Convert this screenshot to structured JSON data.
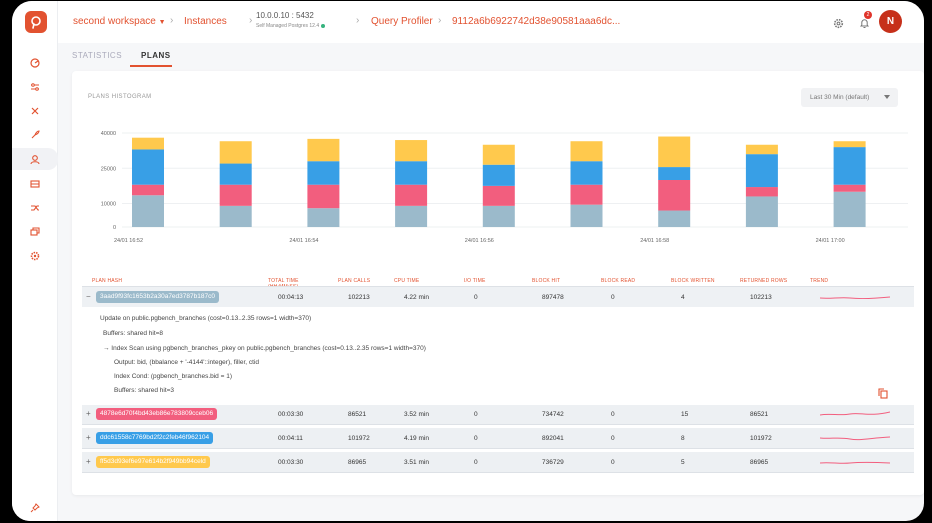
{
  "colors": {
    "accent": "#e25230",
    "series": [
      "#9bbacb",
      "#f25e7e",
      "#389fe6",
      "#ffc94d"
    ]
  },
  "sidebar": {
    "icons": [
      "dashboard-icon",
      "sliders-icon",
      "tools-icon",
      "rocket-icon",
      "user-search-icon",
      "server-icon",
      "shuffle-icon",
      "layers-icon",
      "gear-icon"
    ],
    "bottom_icon": "pin-icon"
  },
  "topbar": {
    "workspace": "second workspace",
    "instances": "Instances",
    "host": "10.0.0.10 : 5432",
    "host_sub": "Self Managed Postgres 12.4",
    "query_profiler": "Query Profiler",
    "query_id": "9112a6b6922742d38e90581aaa6dc...",
    "notif_count": "2",
    "avatar_initial": "N"
  },
  "tabs": [
    {
      "label": "STATISTICS",
      "active": false
    },
    {
      "label": "PLANS",
      "active": true
    }
  ],
  "card": {
    "title": "PLANS HISTOGRAM",
    "range_select": "Last 30 Min (default)"
  },
  "chart_data": {
    "type": "bar",
    "stacked": true,
    "title": "PLANS HISTOGRAM",
    "ylim": [
      0,
      40000
    ],
    "yticks": [
      "40000",
      "25000",
      "10000",
      "0"
    ],
    "ytick_values": [
      40000,
      25000,
      10000,
      0
    ],
    "xticks": [
      "24/01 16:52",
      "24/01 16:54",
      "24/01 16:56",
      "24/01 16:58",
      "24/01 17:00"
    ],
    "categories": [
      "1",
      "2",
      "3",
      "4",
      "5",
      "6",
      "7",
      "8",
      "9",
      "10",
      "11"
    ],
    "series": [
      {
        "values": [
          13500,
          9000,
          8000,
          9000,
          9000,
          9500,
          7000,
          13000,
          15000,
          15000,
          2500
        ]
      },
      {
        "values": [
          4500,
          9000,
          10000,
          9000,
          8500,
          8500,
          13000,
          4000,
          3000,
          2500,
          15000
        ]
      },
      {
        "values": [
          15000,
          9000,
          10000,
          10000,
          9000,
          10000,
          5500,
          14000,
          16000,
          16000,
          3000
        ]
      },
      {
        "values": [
          5000,
          9500,
          9500,
          9000,
          8500,
          8500,
          13000,
          4000,
          2500,
          2500,
          15000
        ]
      }
    ]
  },
  "table": {
    "headers": [
      "PLAN HASH",
      "TOTAL TIME\n(HH:MM:SS)",
      "PLAN CALLS",
      "CPU TIME",
      "I/O TIME",
      "BLOCK HIT",
      "BLOCK READ",
      "BLOCK WRITTEN",
      "RETURNED ROWS",
      "TREND"
    ],
    "rows": [
      {
        "expand": "−",
        "hash": "3aad9f93fc1653b2a30a7ed3787b187c0",
        "color": "#9bbacb",
        "total": "00:04:13",
        "calls": "102213",
        "cpu": "4.22 min",
        "io": "0",
        "hit": "897478",
        "read": "0",
        "written": "4",
        "rows": "102213"
      },
      {
        "expand": "+",
        "hash": "4878e6d70f4bd43eb86e783809cceb06",
        "color": "#f25e7e",
        "total": "00:03:30",
        "calls": "86521",
        "cpu": "3.52 min",
        "io": "0",
        "hit": "734742",
        "read": "0",
        "written": "15",
        "rows": "86521"
      },
      {
        "expand": "+",
        "hash": "ddc61558c7769bd2f2c2feb46f962104",
        "color": "#389fe6",
        "total": "00:04:11",
        "calls": "101972",
        "cpu": "4.19 min",
        "io": "0",
        "hit": "892041",
        "read": "0",
        "written": "8",
        "rows": "101972"
      },
      {
        "expand": "+",
        "hash": "ff5d3d93ef6e97e614b2f949bb94celd",
        "color": "#ffc94d",
        "total": "00:03:30",
        "calls": "86965",
        "cpu": "3.51 min",
        "io": "0",
        "hit": "736729",
        "read": "0",
        "written": "5",
        "rows": "86965"
      }
    ],
    "detail": [
      "Update on public.pgbench_branches  (cost=0.13..2.35 rows=1 width=370)",
      "Buffers: shared hit=8",
      "→  Index Scan using pgbench_branches_pkey on public.pgbench_branches  (cost=0.13..2.35 rows=1 width=370)",
      "Output: bid, (bbalance + '-4144'::integer), filler, ctid",
      "Index Cond: (pgbench_branches.bid = 1)",
      "Buffers: shared hit=3"
    ],
    "copy_icon": "copy-icon"
  }
}
